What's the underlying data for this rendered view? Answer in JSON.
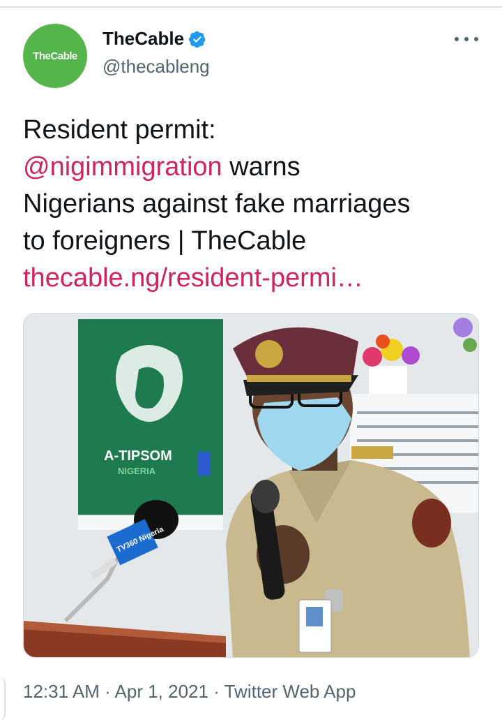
{
  "account": {
    "avatar_text": "TheCable",
    "display_name": "TheCable",
    "handle": "@thecableng"
  },
  "tweet": {
    "line1": "Resident permit:",
    "mention": "@nigimmigration",
    "line2_rest": " warns",
    "line3": "Nigerians against fake marriages",
    "line4": "to foreigners | TheCable",
    "link": "thecable.ng/resident-permi…"
  },
  "media": {
    "poster_title": "A-TIPSOM",
    "poster_subtitle": "NIGERIA",
    "mic_label": "TV360 Nigeria"
  },
  "meta": {
    "time": "12:31 AM",
    "date": "Apr 1, 2021",
    "source": "Twitter Web App",
    "separator": " · "
  },
  "colors": {
    "brand_green": "#53b54a",
    "link": "#d0245e",
    "verified": "#1d9bf0"
  },
  "icons": [
    "verified-badge-icon",
    "more-options-icon"
  ]
}
